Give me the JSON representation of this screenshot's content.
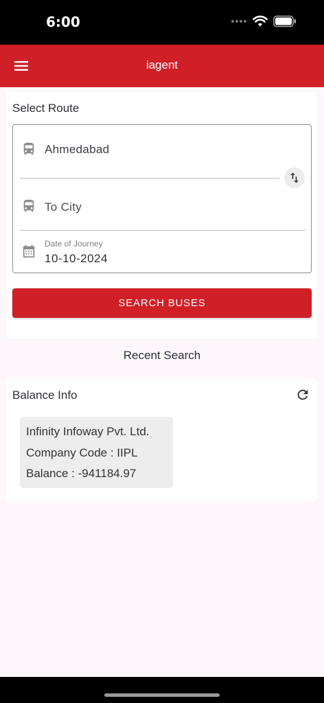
{
  "status_bar": {
    "time": "6:00",
    "icons": [
      "signal-dots-icon",
      "wifi-icon",
      "battery-icon"
    ]
  },
  "app_bar": {
    "title": "iagent",
    "menu_icon": "hamburger-menu-icon",
    "color": "#d01f27"
  },
  "route": {
    "section_title": "Select Route",
    "from_city": "Ahmedabad",
    "to_city_placeholder": "To City",
    "date_label": "Date of Journey",
    "date_value": "10-10-2024",
    "search_button": "SEARCH BUSES",
    "icons": {
      "from": "bus-icon",
      "to": "bus-icon",
      "swap": "swap-vertical-icon",
      "date": "calendar-icon"
    }
  },
  "recent_search_label": "Recent Search",
  "balance": {
    "title": "Balance Info",
    "refresh_icon": "refresh-icon",
    "company_name": "Infinity Infoway Pvt. Ltd.",
    "company_code": "Company Code : IIPL",
    "balance_text": "Balance : -941184.97"
  }
}
